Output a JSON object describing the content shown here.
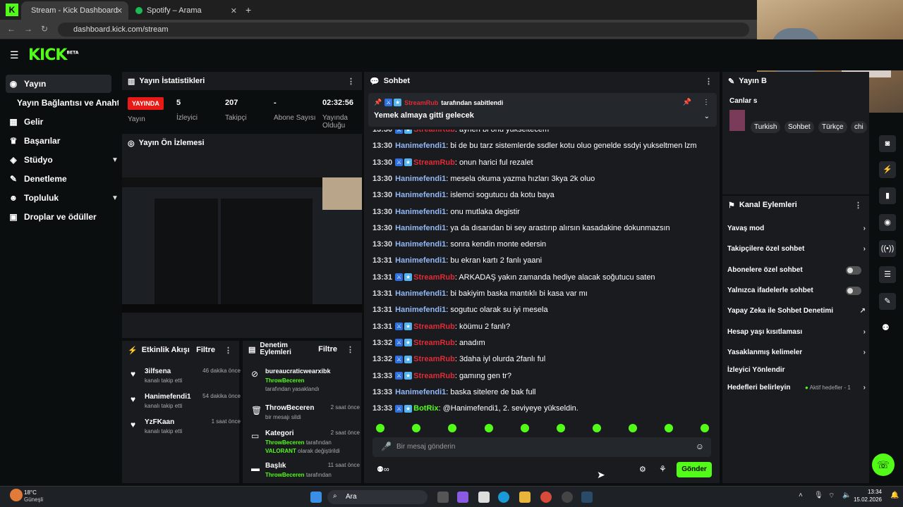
{
  "browser": {
    "tabs": [
      {
        "label": "Stream - Kick Dashboard"
      },
      {
        "label": "Spotify – Arama"
      }
    ],
    "url": "dashboard.kick.com/stream",
    "new_tab": "+"
  },
  "app": {
    "logo": "KICK",
    "logo_sup": "BETA"
  },
  "sidebar": {
    "items": [
      {
        "label": "Yayın"
      },
      {
        "label": "Yayın Bağlantısı ve Anahtarı"
      },
      {
        "label": "Gelir"
      },
      {
        "label": "Başarılar"
      },
      {
        "label": "Stüdyo"
      },
      {
        "label": "Denetleme"
      },
      {
        "label": "Topluluk"
      },
      {
        "label": "Droplar ve ödüller"
      }
    ]
  },
  "stats": {
    "title": "Yayın İstatistikleri",
    "live_label": "YAYINDA",
    "status_label": "Yayın",
    "viewers": "5",
    "viewers_label": "İzleyici",
    "followers": "207",
    "followers_label": "Takipçi",
    "subs": "-",
    "subs_label": "Abone Sayısı",
    "duration": "02:32:56",
    "duration_label": "Yayında Olduğu"
  },
  "preview": {
    "title": "Yayın Ön İzlemesi"
  },
  "activity": {
    "title": "Etkinlik Akışı",
    "filter": "Filtre",
    "items": [
      {
        "user": "3ilfsena",
        "desc": "kanalı takip etti",
        "time": "46 dakika önce"
      },
      {
        "user": "Hanimefendi1",
        "desc": "kanalı takip etti",
        "time": "54 dakika önce"
      },
      {
        "user": "YzFKaan",
        "desc": "kanalı takip etti",
        "time": "1 saat önce"
      }
    ]
  },
  "modlog": {
    "title": "Denetim Eylemleri",
    "filter": "Filtre",
    "items": [
      {
        "user": "bureaucraticwearxibk",
        "actor": "ThrowBeceren",
        "desc": "tarafından yasaklandı",
        "time": "2 saat önce"
      },
      {
        "user": "ThrowBeceren",
        "desc": "bir mesajı sildi",
        "time": "2 saat önce"
      },
      {
        "user": "Kategori",
        "actor": "ThrowBeceren",
        "desc": "tarafından",
        "desc2": "VALORANT",
        "desc3": "olarak değiştirildi",
        "time": "2 saat önce"
      },
      {
        "user": "Başlık",
        "actor": "ThrowBeceren",
        "desc": "tarafından",
        "time": "11 saat önce"
      }
    ]
  },
  "chat": {
    "title": "Sohbet",
    "pinned_by": "StreamRub",
    "pinned_by_suffix": "tarafından sabitlendi",
    "pinned_msg": "Yemek almaya gitti gelecek",
    "placeholder": "Bir mesaj gönderin",
    "send": "Gönder",
    "messages": [
      {
        "t": "13:30",
        "u": "StreamRub",
        "c": "u2",
        "m": ": aynen bi onu yukseltecem",
        "b": true
      },
      {
        "t": "13:30",
        "u": "Hanimefendi1",
        "c": "u1",
        "m": ": bi de bu tarz sistemlerde ssdler kotu oluo genelde ssdyi yukseltmen lzm",
        "b": false
      },
      {
        "t": "13:30",
        "u": "StreamRub",
        "c": "u2",
        "m": ": onun harici ful rezalet",
        "b": true
      },
      {
        "t": "13:30",
        "u": "Hanimefendi1",
        "c": "u1",
        "m": ": mesela okuma yazma hızları 3kya 2k oluo",
        "b": false
      },
      {
        "t": "13:30",
        "u": "Hanimefendi1",
        "c": "u1",
        "m": ": islemci sogutucu da kotu baya",
        "b": false
      },
      {
        "t": "13:30",
        "u": "Hanimefendi1",
        "c": "u1",
        "m": ": onu mutlaka degistir",
        "b": false
      },
      {
        "t": "13:30",
        "u": "Hanimefendi1",
        "c": "u1",
        "m": ": ya da dısarıdan bi sey arastırıp alırsın kasadakine dokunmazsın",
        "b": false
      },
      {
        "t": "13:30",
        "u": "Hanimefendi1",
        "c": "u1",
        "m": ": sonra kendin monte edersin",
        "b": false
      },
      {
        "t": "13:31",
        "u": "Hanimefendi1",
        "c": "u1",
        "m": ": bu ekran kartı 2 fanlı yaani",
        "b": false
      },
      {
        "t": "13:31",
        "u": "StreamRub",
        "c": "u2",
        "m": ": ARKADAŞ yakın zamanda hediye alacak soğutucu saten",
        "b": true
      },
      {
        "t": "13:31",
        "u": "Hanimefendi1",
        "c": "u1",
        "m": ": bi bakiyim baska mantıklı bi kasa var mı",
        "b": false
      },
      {
        "t": "13:31",
        "u": "Hanimefendi1",
        "c": "u1",
        "m": ": sogutuc olarak su iyi mesela",
        "b": false
      },
      {
        "t": "13:31",
        "u": "StreamRub",
        "c": "u2",
        "m": ": köümu 2 fanlı?",
        "b": true
      },
      {
        "t": "13:32",
        "u": "StreamRub",
        "c": "u2",
        "m": ": anadım",
        "b": true
      },
      {
        "t": "13:32",
        "u": "StreamRub",
        "c": "u2",
        "m": ": 3daha iyl olurda 2fanlı ful",
        "b": true
      },
      {
        "t": "13:33",
        "u": "StreamRub",
        "c": "u2",
        "m": ": gamıng gen tr?",
        "b": true
      },
      {
        "t": "13:33",
        "u": "Hanimefendi1",
        "c": "u1",
        "m": ": baska sitelere de bak full",
        "b": false
      },
      {
        "t": "13:33",
        "u": "BotRix",
        "c": "u3",
        "m": ": @Hanimefendi1, 2. seviyeye yükseldin.",
        "b": true
      }
    ]
  },
  "stream_info": {
    "title": "Yayın B",
    "canlar": "Canlar s",
    "tags": [
      "Turkish",
      "Sohbet",
      "Türkçe",
      "chi"
    ]
  },
  "channel_actions": {
    "title": "Kanal Eylemleri",
    "items": [
      {
        "label": "Yavaş mod"
      },
      {
        "label": "Takipçilere özel sohbet"
      },
      {
        "label": "Abonelere özel sohbet"
      },
      {
        "label": "Yalnızca ifadelerle sohbet"
      },
      {
        "label": "Yapay Zeka ile Sohbet Denetimi"
      },
      {
        "label": "Hesap yaşı kısıtlaması"
      },
      {
        "label": "Yasaklanmış kelimeler"
      },
      {
        "label": "İzleyici Yönlendir"
      },
      {
        "label": "Hedefleri belirleyin"
      }
    ],
    "active_goals": "Aktif hedefler - 1"
  },
  "taskbar": {
    "temp": "18°C",
    "weather": "Güneşli",
    "search": "Ara",
    "time": "13:34",
    "date": "15.02.2026"
  },
  "colors": {
    "accent": "#53fc18",
    "live": "#e91916",
    "panel": "#191b1f"
  }
}
